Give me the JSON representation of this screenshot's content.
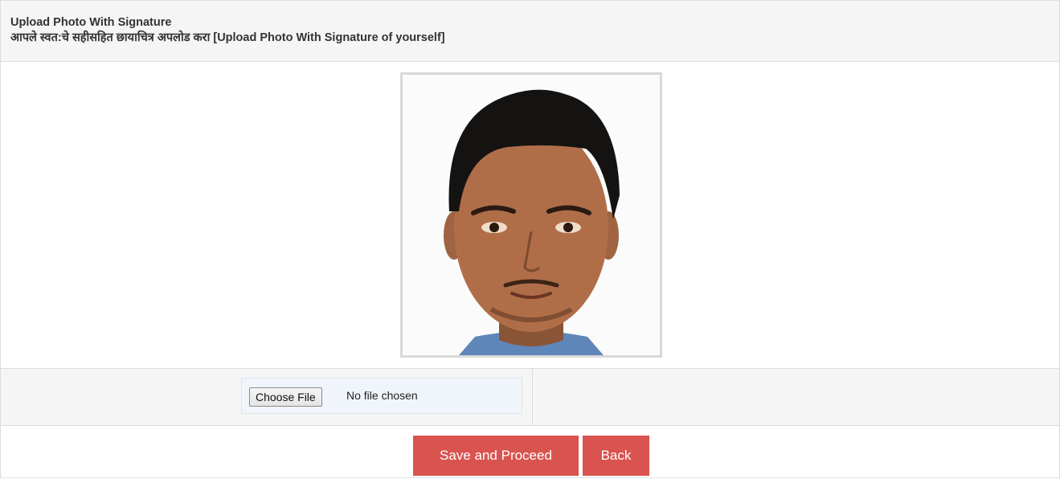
{
  "header": {
    "title": "Upload Photo With Signature",
    "subtitle": "आपले स्वत:चे सहीसहित छायाचित्र अपलोड करा [Upload Photo With Signature of yourself]"
  },
  "photo": {
    "icon": "uploaded-photo-preview"
  },
  "upload": {
    "choose_label": "Choose File",
    "status": "No file chosen"
  },
  "actions": {
    "save_label": "Save and Proceed",
    "back_label": "Back"
  },
  "colors": {
    "button": "#d9534f",
    "header_bg": "#f5f5f5"
  }
}
